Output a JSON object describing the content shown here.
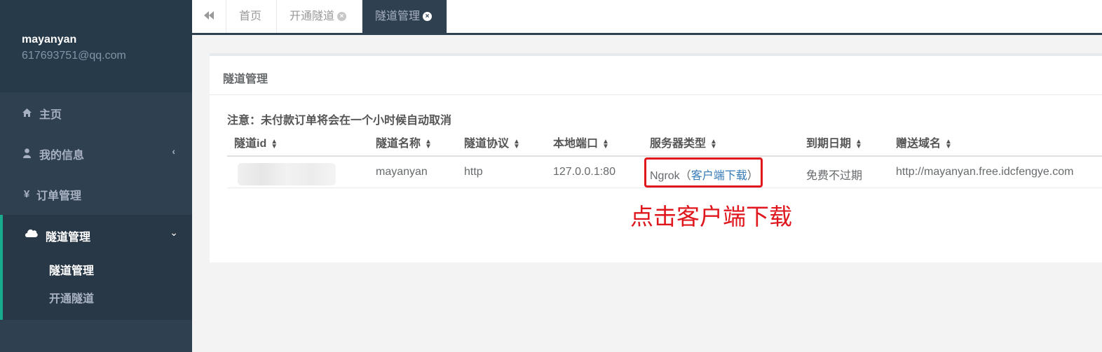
{
  "sidebar": {
    "user_name": "mayanyan",
    "user_email": "617693751@qq.com",
    "items": [
      {
        "label": "主页",
        "icon": "home-icon"
      },
      {
        "label": "我的信息",
        "icon": "user-icon"
      },
      {
        "label": "订单管理",
        "icon": "yen-icon"
      },
      {
        "label": "隧道管理",
        "icon": "cloud-icon"
      }
    ],
    "sub_items": [
      {
        "label": "隧道管理",
        "active": true
      },
      {
        "label": "开通隧道",
        "active": false
      }
    ]
  },
  "tabs": [
    {
      "label": "首页"
    },
    {
      "label": "开通隧道"
    },
    {
      "label": "隧道管理",
      "active": true
    }
  ],
  "panel": {
    "title": "隧道管理",
    "notice": "注意：未付款订单将会在一个小时候自动取消"
  },
  "table": {
    "columns": [
      "隧道id",
      "隧道名称",
      "隧道协议",
      "本地端口",
      "服务器类型",
      "到期日期",
      "赠送域名"
    ],
    "row": {
      "id": "",
      "name": "mayanyan",
      "protocol": "http",
      "local_port": "127.0.0.1:80",
      "server_type": "Ngrok",
      "download_link": "客户端下载",
      "expiry": "免费不过期",
      "domain": "http://mayanyan.free.idcfengye.com"
    }
  },
  "annotation": "点击客户端下载",
  "colors": {
    "sidebar": "#2f4050",
    "accent": "#19aa8d",
    "link": "#337ab7",
    "annotation": "#e0161d"
  }
}
